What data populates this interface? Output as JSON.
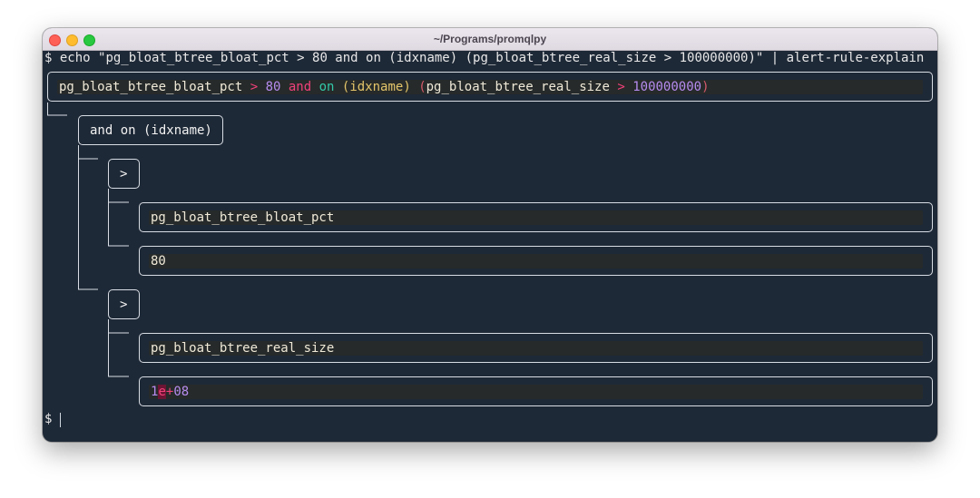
{
  "window": {
    "title": "~/Programs/promqlpy"
  },
  "command": {
    "prompt": "$",
    "text": " echo \"pg_bloat_btree_bloat_pct > 80 and on (idxname) (pg_bloat_btree_real_size > 100000000)\" | alert-rule-explain"
  },
  "root_expr": {
    "metric1": "pg_bloat_btree_bloat_pct",
    "op1": " > ",
    "num1": "80",
    "kw_and": " and ",
    "kw_on": "on",
    "label_group": " (idxname) ",
    "open_paren": "(",
    "metric2": "pg_bloat_btree_real_size",
    "op2": " > ",
    "num2": "100000000",
    "close_paren": ")"
  },
  "tree": {
    "and_node": "and on (idxname)",
    "gt_node_1": ">",
    "metric_node_1": "pg_bloat_btree_bloat_pct",
    "number_node_1": "80",
    "gt_node_2": ">",
    "metric_node_2": "pg_bloat_btree_real_size",
    "number_node_2": {
      "mantissa": "1",
      "exp_e": "e",
      "exp_plus": "+",
      "exp_digits": "08"
    }
  },
  "final_prompt": "$",
  "colors": {
    "background": "#1e2937",
    "operator": "#f0417a",
    "number": "#b78cf0",
    "keyword_on": "#33c9a8",
    "identifier": "#efe9d8",
    "paren": "#e4c56a"
  }
}
